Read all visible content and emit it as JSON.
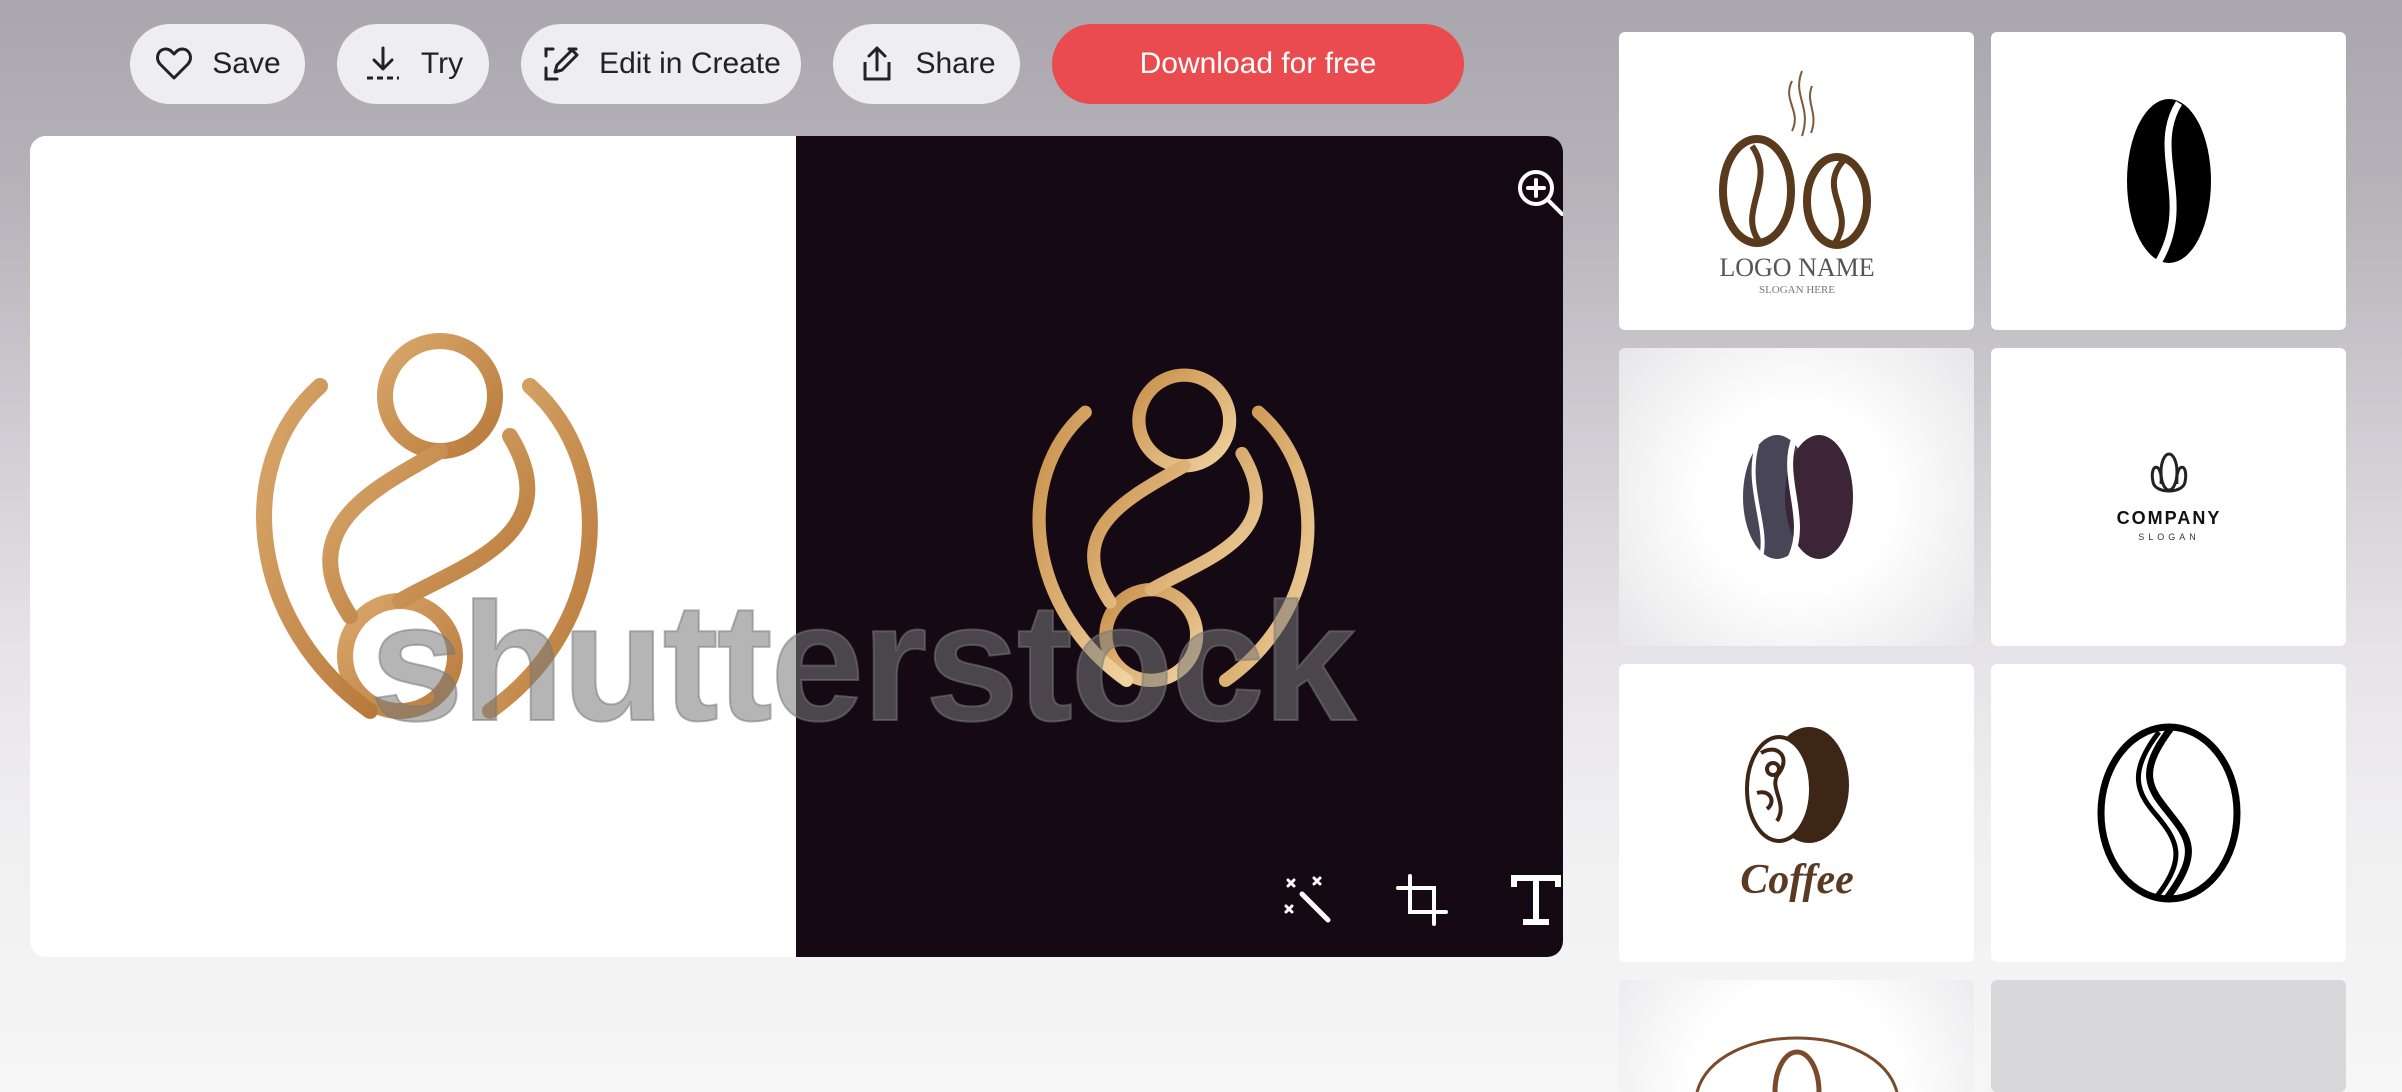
{
  "toolbar": {
    "save_label": "Save",
    "try_label": "Try",
    "edit_label": "Edit in Create",
    "share_label": "Share",
    "download_label": "Download for free"
  },
  "preview": {
    "watermark": "shutterstock"
  },
  "thumbnails": {
    "t1_title": "LOGO NAME",
    "t1_slogan": "SLOGAN HERE",
    "t4_title": "COMPANY",
    "t4_slogan": "SLOGAN",
    "t5_title": "Coffee"
  },
  "colors": {
    "download": "#e94b4f",
    "dark_panel": "#150a14",
    "gold": "#c8904a"
  }
}
